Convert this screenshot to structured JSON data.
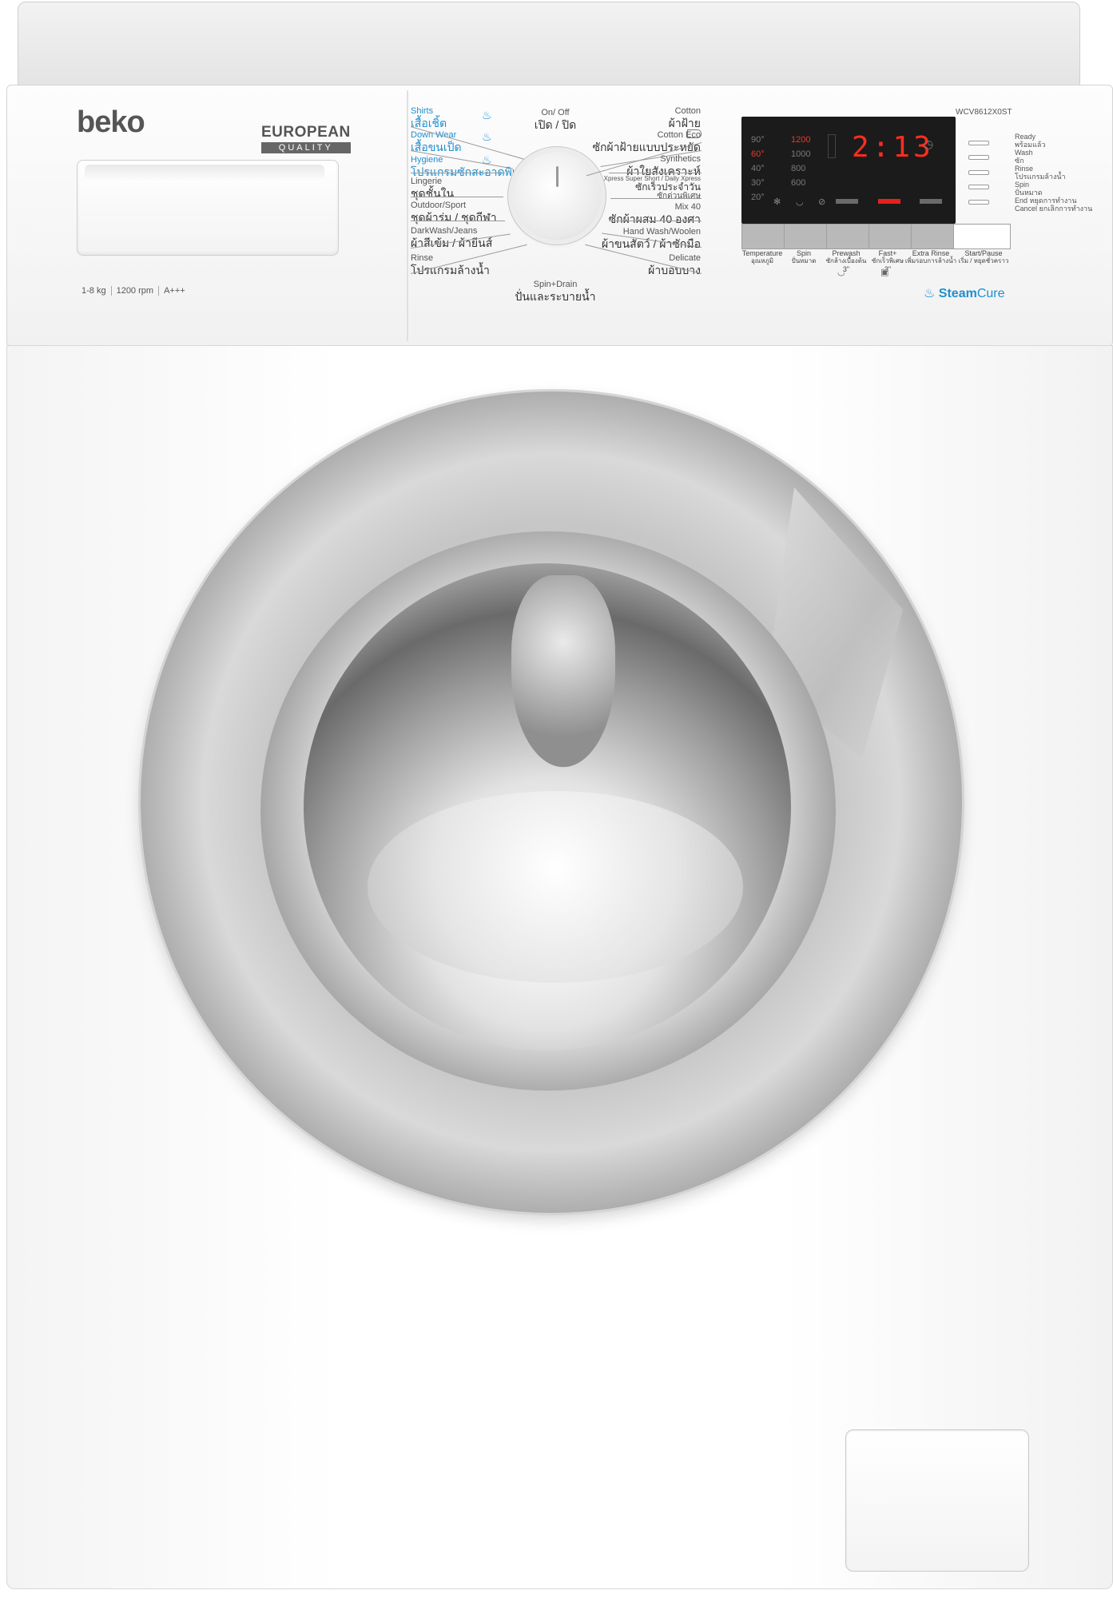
{
  "brand": {
    "name": "beko",
    "quality_line1": "EUROPEAN",
    "quality_line2": "QUALITY"
  },
  "specs": [
    "1-8 kg",
    "1200 rpm",
    "A+++"
  ],
  "model": "WCV8612X0ST",
  "programs_left": [
    {
      "en": "Shirts",
      "th": "เสื้อเชิ้ต",
      "highlight": true
    },
    {
      "en": "Down Wear",
      "th": "เสื้อขนเป็ด",
      "highlight": true
    },
    {
      "en": "Hygiene",
      "th": "โปรแกรมซักสะอาดพิเศษ",
      "highlight": true
    },
    {
      "en": "Lingerie",
      "th": "ชุดชั้นใน",
      "highlight": false
    },
    {
      "en": "Outdoor/Sport",
      "th": "ชุดผ้าร่ม / ชุดกีฬา",
      "highlight": false
    },
    {
      "en": "DarkWash/Jeans",
      "th": "ผ้าสีเข้ม / ผ้ายีนส์",
      "highlight": false
    },
    {
      "en": "Rinse",
      "th": "โปรแกรมล้างน้ำ",
      "highlight": false
    }
  ],
  "programs_right": [
    {
      "en": "Cotton",
      "th": "ผ้าฝ้าย"
    },
    {
      "en": "Cotton Eco",
      "th": "ซักผ้าฝ้ายแบบประหยัด"
    },
    {
      "en": "Synthetics",
      "th": "ผ้าใยสังเคราะห์"
    },
    {
      "en": "Xpress Super Short / Daily Xpress",
      "th": "ซักเร็วประจำวัน",
      "th2": "ซักด่วนพิเศษ"
    },
    {
      "en": "Mix 40",
      "th": "ซักผ้าผสม 40 องศา"
    },
    {
      "en": "Hand Wash/Woolen",
      "th": "ผ้าขนสัตว์ / ผ้าซักมือ"
    },
    {
      "en": "Delicate",
      "th": "ผ้าบอบบาง"
    }
  ],
  "programs_center": {
    "top": {
      "en": "On/ Off",
      "th": "เปิด / ปิด"
    },
    "bottom": {
      "en": "Spin+Drain",
      "th": "ปั่นและระบายน้ำ"
    }
  },
  "display": {
    "temperatures": [
      "90°",
      "60°",
      "40°",
      "30°",
      "20°"
    ],
    "active_temperature": "60°",
    "spins": [
      "1200",
      "1000",
      "800",
      "600"
    ],
    "active_spin": "1200",
    "time": "2:13"
  },
  "buttons": [
    {
      "en": "Temperature",
      "th": "อุณหภูมิ"
    },
    {
      "en": "Spin",
      "th": "ปั่นหมาด"
    },
    {
      "en": "Prewash",
      "th": "ซักล้างเบื้องต้น",
      "sub": "3\""
    },
    {
      "en": "Fast+",
      "th": "ซักเร็วพิเศษ",
      "sub": "3\""
    },
    {
      "en": "Extra Rinse",
      "th": "เพิ่มรอบการล้างน้ำ"
    },
    {
      "en": "Start/Pause",
      "th": "เริ่ม / หยุดชั่วคราว"
    }
  ],
  "status": [
    {
      "en": "Ready",
      "th": "พร้อมแล้ว"
    },
    {
      "en": "Wash",
      "th": "ซัก"
    },
    {
      "en": "Rinse",
      "th": "โปรแกรมล้างน้ำ"
    },
    {
      "en": "Spin",
      "th": "ปั่นหมาด"
    },
    {
      "en": "End",
      "th": "หยุดการทำงาน"
    },
    {
      "en": "Cancel",
      "th": "ยกเลิกการทำงาน"
    }
  ],
  "feature": {
    "steam": "Steam",
    "cure": "Cure"
  },
  "colors": {
    "accent_blue": "#1e8fd0",
    "led_red": "#ff2d1f",
    "display_bg": "#1b1b1b"
  },
  "icons": [
    "shirt-icon",
    "steam-icon",
    "snowflake-icon",
    "tub-icon",
    "no-crease-icon",
    "clock-icon",
    "lock-icon"
  ]
}
